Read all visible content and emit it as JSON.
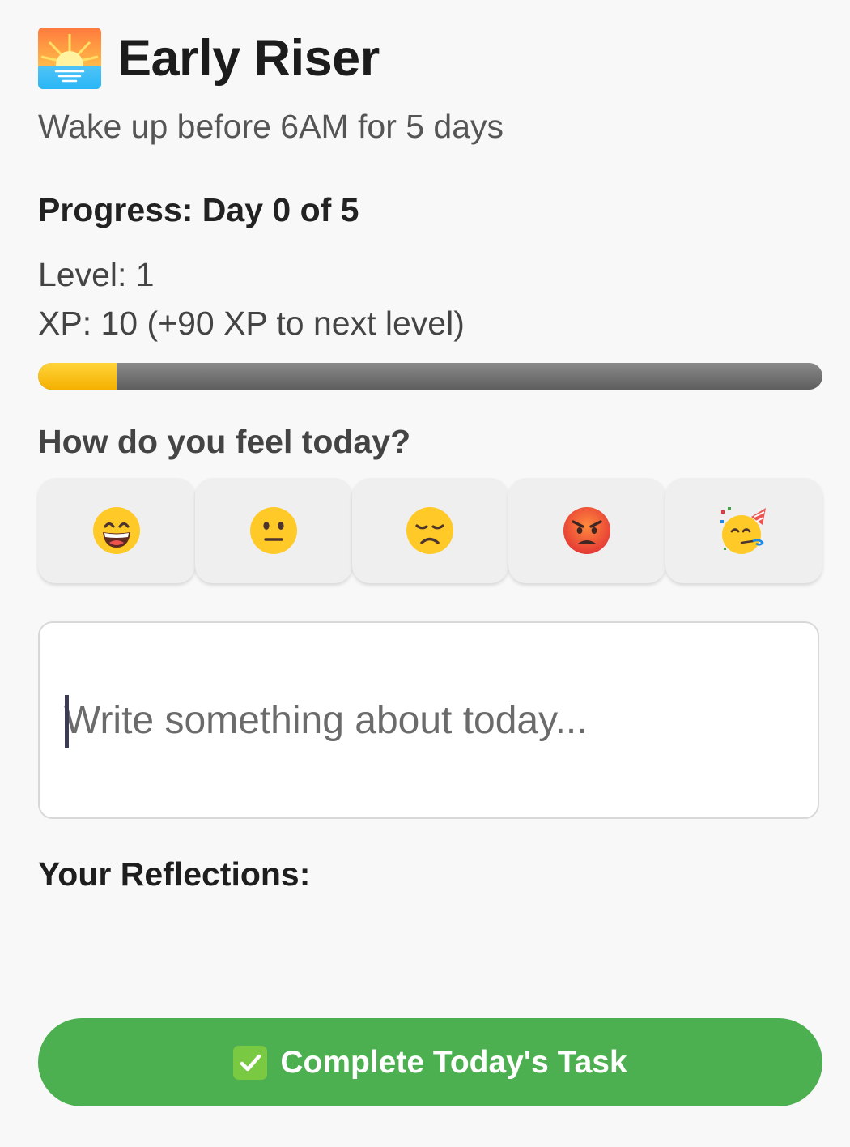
{
  "challenge": {
    "icon": "sunrise-icon",
    "title": "Early Riser",
    "subtitle": "Wake up before 6AM for 5 days"
  },
  "progress": {
    "label": "Progress: Day 0 of 5"
  },
  "stats": {
    "level_text": "Level: 1",
    "xp_text": "XP: 10 (+90 XP to next level)",
    "xp_fraction": 0.1,
    "xp_fill_color": "#ffc107",
    "xp_track_color": "#707070"
  },
  "mood": {
    "question": "How do you feel today?",
    "options": [
      {
        "icon": "grinning-face-icon"
      },
      {
        "icon": "neutral-face-icon"
      },
      {
        "icon": "disappointed-face-icon"
      },
      {
        "icon": "angry-face-icon"
      },
      {
        "icon": "partying-face-icon"
      }
    ]
  },
  "reflection_input": {
    "placeholder": "Write something about today...",
    "value": ""
  },
  "reflections": {
    "heading": "Your Reflections:"
  },
  "complete_button": {
    "icon": "check-mark-icon",
    "label": "Complete Today's Task",
    "color": "#4caf50"
  }
}
